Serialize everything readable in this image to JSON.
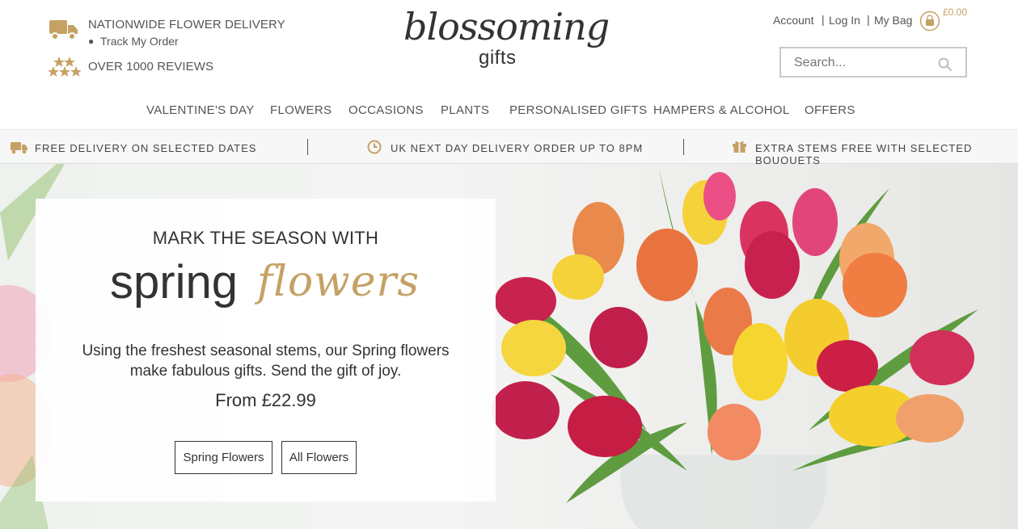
{
  "header": {
    "delivery_title": "NATIONWIDE FLOWER DELIVERY",
    "track_order": "Track My Order",
    "reviews": "OVER 1000 REVIEWS",
    "logo_word": "blossoming",
    "logo_sub": "gifts",
    "links": {
      "account": "Account",
      "login": "Log In",
      "bag": "My Bag",
      "bag_total": "£0.00"
    },
    "search_placeholder": "Search..."
  },
  "nav": [
    "VALENTINE'S DAY",
    "FLOWERS",
    "OCCASIONS",
    "PLANTS",
    "PERSONALISED GIFTS",
    "HAMPERS & ALCOHOL",
    "OFFERS"
  ],
  "usp": [
    {
      "icon": "truck-icon",
      "text": "FREE DELIVERY ON SELECTED DATES"
    },
    {
      "icon": "clock-icon",
      "text": "UK NEXT DAY DELIVERY ORDER UP TO 8PM"
    },
    {
      "icon": "gift-icon",
      "text": "EXTRA STEMS FREE WITH SELECTED BOUQUETS"
    }
  ],
  "hero": {
    "kicker": "MARK THE SEASON WITH",
    "title_main": "spring",
    "title_script": "flowers",
    "copy_line1": "Using the freshest seasonal stems, our Spring flowers",
    "copy_line2": "make fabulous gifts. Send the gift of joy.",
    "price": "From £22.99",
    "buttons": {
      "spring": "Spring Flowers",
      "all": "All Flowers"
    }
  },
  "colors": {
    "accent": "#c5a165",
    "text": "#333333"
  }
}
